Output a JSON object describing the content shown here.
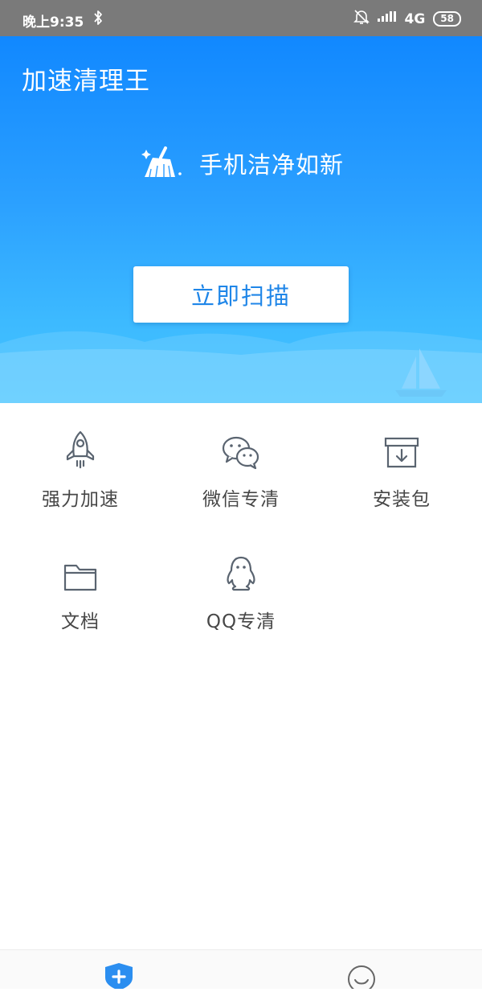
{
  "status_bar": {
    "time": "晚上9:35",
    "network": "4G",
    "battery": "58",
    "icons": [
      "bluetooth-icon",
      "mute-bell-icon",
      "signal-icon",
      "battery-icon"
    ]
  },
  "header": {
    "app_title": "加速清理王",
    "slogan": "手机洁净如新",
    "scan_button_label": "立即扫描"
  },
  "features": [
    {
      "label": "强力加速",
      "icon": "rocket-icon"
    },
    {
      "label": "微信专清",
      "icon": "wechat-icon"
    },
    {
      "label": "安装包",
      "icon": "package-box-icon"
    },
    {
      "label": "文档",
      "icon": "folder-icon"
    },
    {
      "label": "QQ专清",
      "icon": "qq-penguin-icon"
    }
  ],
  "bottom_nav": {
    "items": [
      {
        "icon": "shield-plus-icon",
        "active": true
      },
      {
        "icon": "smile-profile-icon",
        "active": false
      }
    ]
  },
  "colors": {
    "accent": "#1f86e8",
    "hero_top": "#1188ff",
    "hero_bottom": "#44c4ff",
    "icon_stroke": "#5a6470",
    "label_text": "#474747"
  }
}
